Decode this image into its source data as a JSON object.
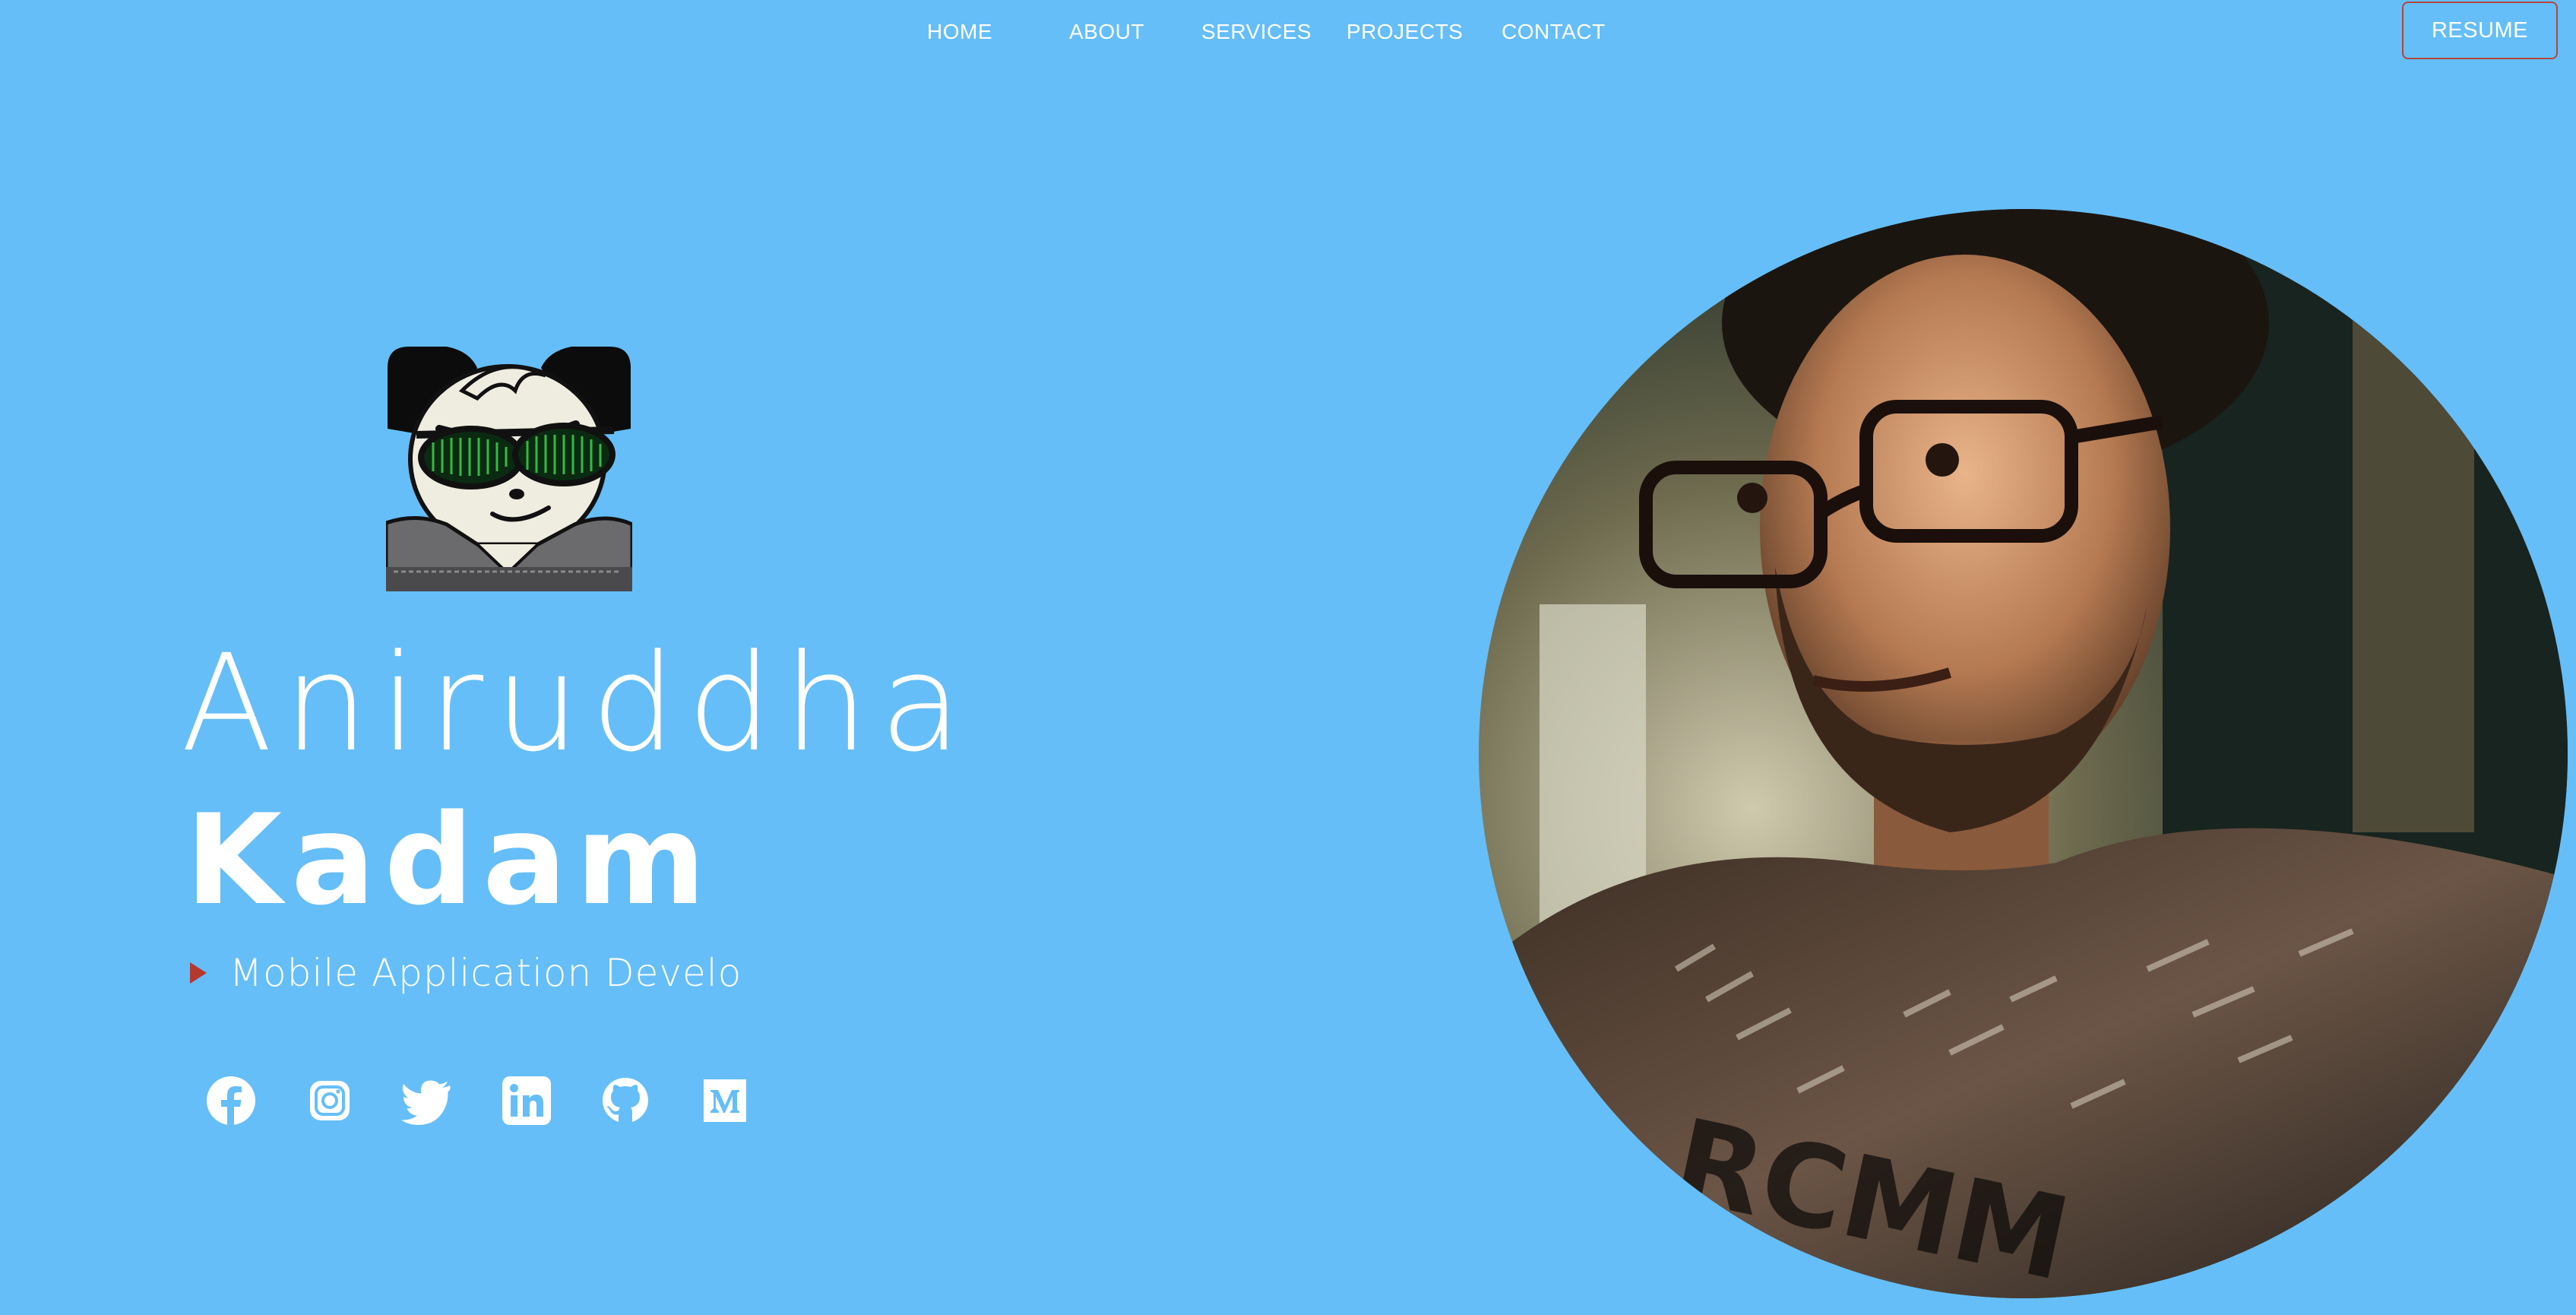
{
  "nav": {
    "items": [
      {
        "label": "HOME"
      },
      {
        "label": "ABOUT"
      },
      {
        "label": "SERVICES"
      },
      {
        "label": "PROJECTS"
      },
      {
        "label": "CONTACT"
      }
    ],
    "resume_label": "RESUME"
  },
  "hero": {
    "first_name": "Aniruddha",
    "last_name": "Kadam",
    "role_text": "Mobile Application Develo"
  },
  "social": [
    {
      "icon": "facebook-icon"
    },
    {
      "icon": "instagram-icon"
    },
    {
      "icon": "twitter-icon"
    },
    {
      "icon": "linkedin-icon"
    },
    {
      "icon": "github-icon"
    },
    {
      "icon": "medium-icon"
    }
  ],
  "colors": {
    "background": "#65bef8",
    "accent": "#b5392e",
    "text": "#ffffff"
  }
}
